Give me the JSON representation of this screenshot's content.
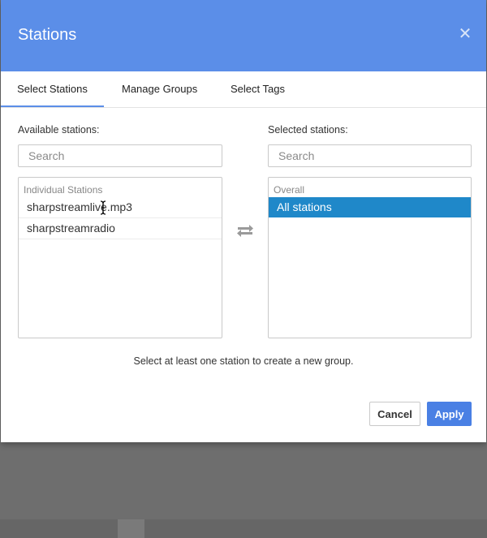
{
  "dialog": {
    "title": "Stations"
  },
  "tabs": [
    {
      "label": "Select Stations",
      "active": true
    },
    {
      "label": "Manage Groups"
    },
    {
      "label": "Select Tags"
    }
  ],
  "available": {
    "label": "Available stations:",
    "search_placeholder": "Search",
    "group_label": "Individual Stations",
    "items": [
      "sharpstreamlive.mp3",
      "sharpstreamradio"
    ]
  },
  "selected": {
    "label": "Selected stations:",
    "search_placeholder": "Search",
    "group_label": "Overall",
    "items": [
      "All stations"
    ]
  },
  "hint": "Select at least one station to create a new group.",
  "buttons": {
    "cancel": "Cancel",
    "apply": "Apply"
  },
  "colors": {
    "header": "#5b8ee8",
    "selected_row": "#1f88c9",
    "apply": "#4a80e4"
  },
  "icons": {
    "close": "close-icon",
    "transfer": "transfer-arrows-icon",
    "cursor": "text-cursor-icon"
  }
}
